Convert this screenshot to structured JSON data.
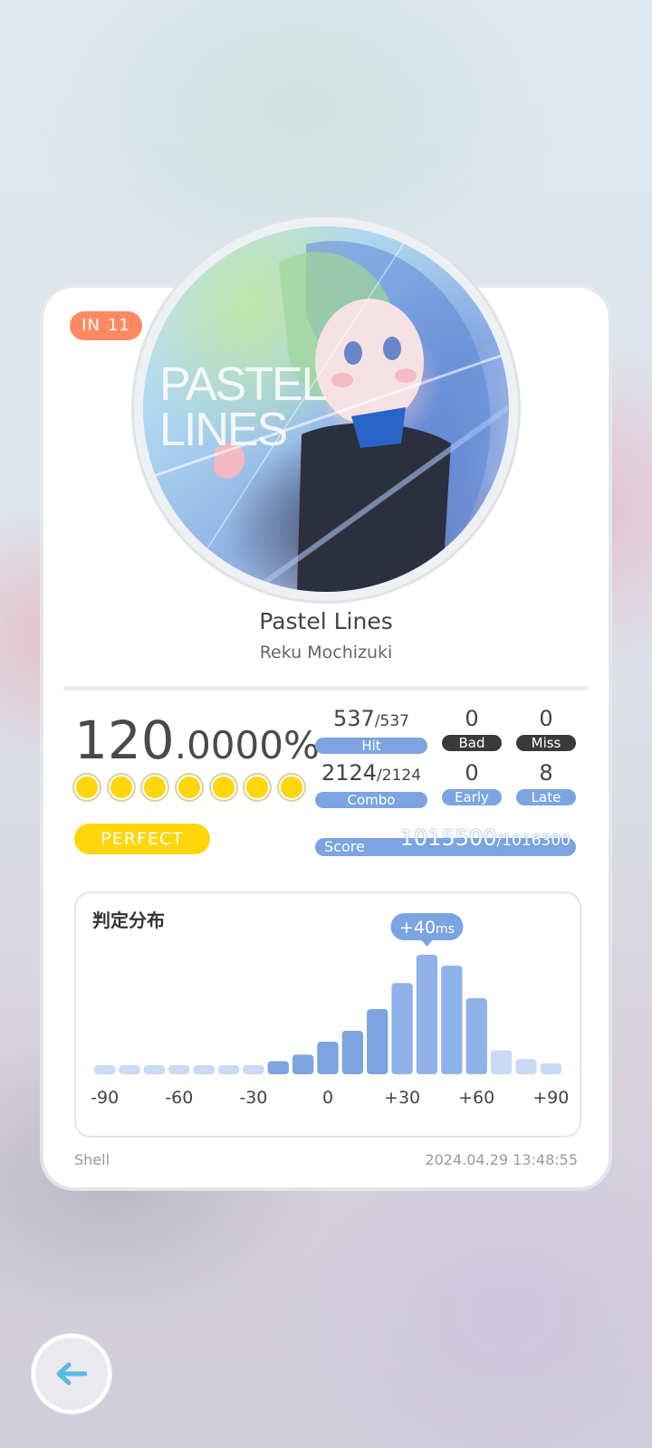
{
  "level": {
    "difficulty": "IN",
    "number": "11"
  },
  "jacket": {
    "art_text_line1": "PASTEL",
    "art_text_line2": "LINES"
  },
  "song": {
    "title": "Pastel Lines",
    "artist": "Reku Mochizuki"
  },
  "result": {
    "accuracy_int": "120",
    "accuracy_dec": ".0000%",
    "circle_count": 7,
    "rank": "PERFECT"
  },
  "stats": {
    "hit": {
      "value": "537",
      "total": "/537",
      "label": "Hit"
    },
    "bad": {
      "value": "0",
      "label": "Bad"
    },
    "miss": {
      "value": "0",
      "label": "Miss"
    },
    "combo": {
      "value": "2124",
      "total": "/2124",
      "label": "Combo"
    },
    "early": {
      "value": "0",
      "label": "Early"
    },
    "late": {
      "value": "8",
      "label": "Late"
    }
  },
  "score": {
    "label": "Score",
    "value": "1015500",
    "max": "/1016300"
  },
  "distribution": {
    "title": "判定分布",
    "peak_value": "+40",
    "peak_unit": "ms"
  },
  "chart_data": {
    "type": "bar",
    "title": "判定分布",
    "x_ticks": [
      "-90",
      "-60",
      "-30",
      "0",
      "+30",
      "+60",
      "+90"
    ],
    "x_range": [
      -90,
      90
    ],
    "bin_width": 10,
    "x": [
      -90,
      -80,
      -70,
      -60,
      -50,
      -40,
      -30,
      -20,
      -10,
      0,
      10,
      20,
      30,
      40,
      50,
      60,
      70,
      80,
      90
    ],
    "values": [
      2,
      2,
      2,
      2,
      3,
      2,
      3,
      6,
      9,
      15,
      20,
      30,
      42,
      55,
      50,
      35,
      11,
      7,
      5
    ],
    "highlight_x": 40,
    "annotation": "+40ms",
    "colors": {
      "low": "#c9daf4",
      "mid": "#7ba4e1",
      "high": "#8fb2ea"
    }
  },
  "footer": {
    "player": "Shell",
    "timestamp": "2024.04.29 13:48:55"
  },
  "colors": {
    "accent_blue": "#7ba4e1",
    "gold": "#ffd60a",
    "level_orange": "#ff8a62",
    "back_arrow": "#5ab8e6"
  },
  "icons": {
    "back": "arrow-left-icon",
    "rank_circle": "gold-circle-icon"
  }
}
